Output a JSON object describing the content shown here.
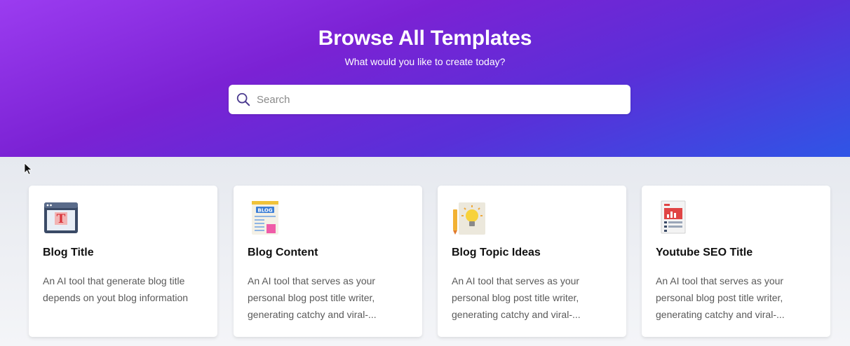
{
  "hero": {
    "title": "Browse All Templates",
    "subtitle": "What would you like to create today?"
  },
  "search": {
    "placeholder": "Search",
    "value": ""
  },
  "colors": {
    "accent": "#7b22d4",
    "gradient_start": "#9b3cf0",
    "gradient_end": "#2f55e6"
  },
  "templates": [
    {
      "title": "Blog Title",
      "description": "An AI tool that generate blog title depends on yout blog information",
      "icon": "blog-title-window-icon"
    },
    {
      "title": "Blog Content",
      "description": "An AI tool that serves as your personal blog post title writer, generating catchy and viral-...",
      "icon": "blog-newspaper-icon"
    },
    {
      "title": "Blog Topic Ideas",
      "description": "An AI tool that serves as your personal blog post title writer, generating catchy and viral-...",
      "icon": "lightbulb-idea-icon"
    },
    {
      "title": "Youtube SEO Title",
      "description": "An AI tool that serves as your personal blog post title writer, generating catchy and viral-...",
      "icon": "seo-report-icon"
    }
  ]
}
